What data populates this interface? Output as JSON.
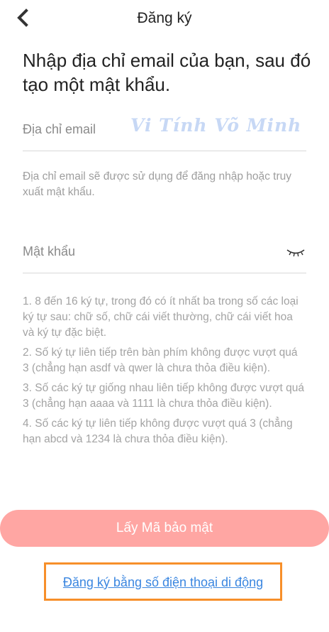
{
  "header": {
    "title": "Đăng ký"
  },
  "heading": "Nhập địa chỉ email của bạn, sau đó tạo một mật khẩu.",
  "email_field": {
    "placeholder": "Địa chỉ email",
    "value": ""
  },
  "watermark": "Vi Tính Võ Minh",
  "email_help": "Địa chỉ email sẽ được sử dụng để đăng nhập hoặc truy xuất mật khẩu.",
  "password_field": {
    "placeholder": "Mật khẩu",
    "value": ""
  },
  "rules": [
    "1. 8 đến 16 ký tự, trong đó có ít nhất ba trong số các loại ký tự sau: chữ số, chữ cái viết thường, chữ cái viết hoa và ký tự đặc biệt.",
    "2. Số ký tự liên tiếp trên bàn phím không được vượt quá 3 (chẳng hạn asdf và qwer là chưa thỏa điều kiện).",
    "3. Số các ký tự giống nhau liên tiếp không được vượt quá 3 (chẳng hạn aaaa và 1111 là chưa thỏa điều kiện).",
    "4. Số các ký tự liên tiếp không được vượt quá 3 (chẳng hạn abcd và 1234 là chưa thỏa điều kiện)."
  ],
  "primary_button": "Lấy Mã bảo mật",
  "phone_signup_link": "Đăng ký bằng số điện thoại di động",
  "icons": {
    "back": "chevron-left-icon",
    "password_toggle": "closed-eye-icon"
  },
  "colors": {
    "button_bg": "#ffa6a3",
    "link": "#3a86e0",
    "highlight_border": "#f78f2a",
    "watermark": "#c7d8f5"
  }
}
